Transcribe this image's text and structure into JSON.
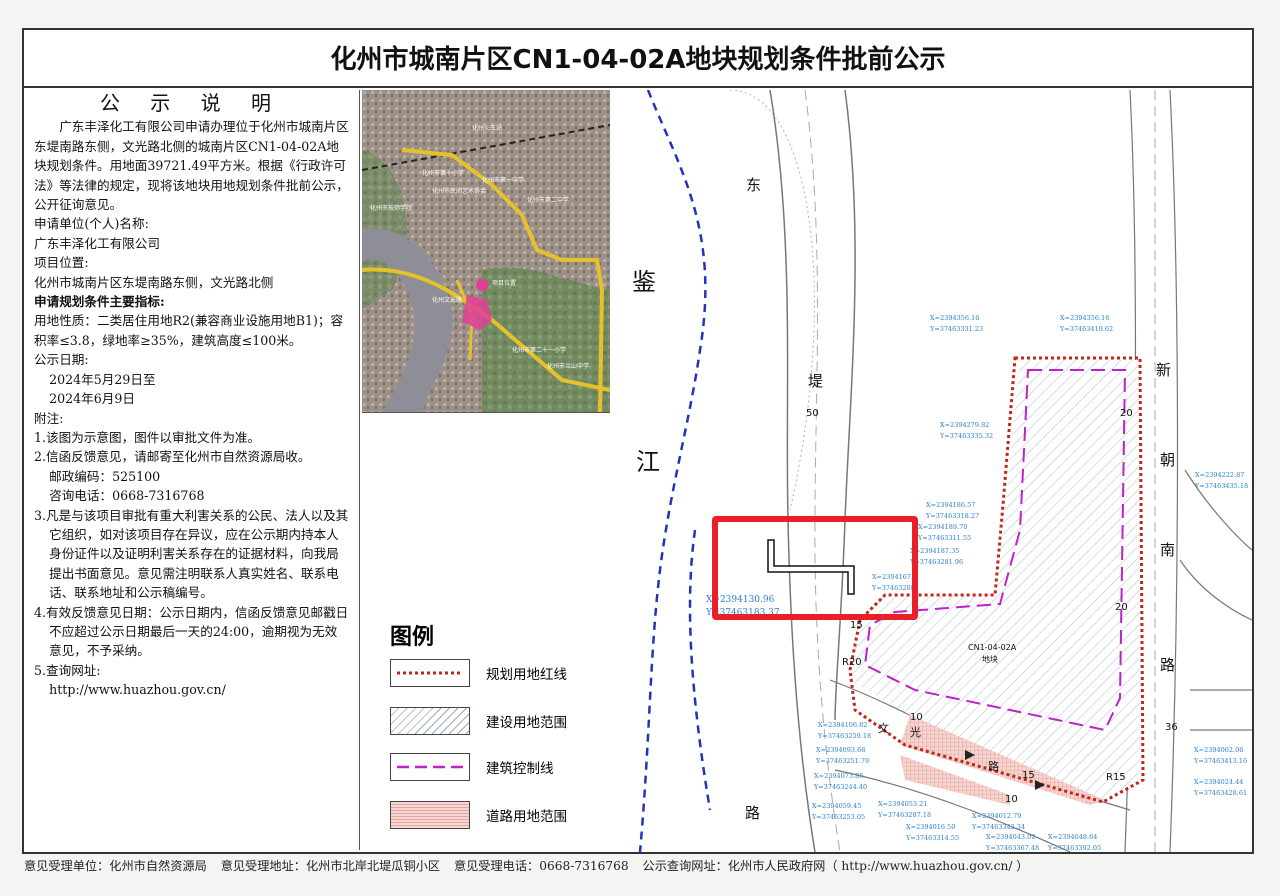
{
  "title": "化州市城南片区CN1-04-02A地块规划条件批前公示",
  "notice": {
    "heading": "公 示 说 明",
    "intro": "广东丰泽化工有限公司申请办理位于化州市城南片区东堤南路东侧，文光路北侧的城南片区CN1-04-02A地块规划条件。用地面39721.49平方米。根据《行政许可法》等法律的规定，现将该地块用地规划条件批前公示，公开征询意见。",
    "applicant_label": "申请单位(个人)名称:",
    "applicant": "广东丰泽化工有限公司",
    "location_label": "项目位置:",
    "location": "化州市城南片区东堤南路东侧，文光路北侧",
    "indicators_label": "申请规划条件主要指标:",
    "indicators": "用地性质：二类居住用地R2(兼容商业设施用地B1)；容积率≤3.8，绿地率≥35%，建筑高度≤100米。",
    "date_label": "公示日期:",
    "date_from": "2024年5月29日至",
    "date_to": "2024年6月9日",
    "notes_label": "附注:",
    "note1": "1.该图为示意图，图件以审批文件为准。",
    "note2": "2.信函反馈意见，请邮寄至化州市自然资源局收。",
    "postcode": "邮政编码：525100",
    "phone": "咨询电话：0668-7316768",
    "note3": "3.凡是与该项目审批有重大利害关系的公民、法人以及其它组织，如对该项目存在异议，应在公示期内持本人身份证件以及证明利害关系存在的证据材料，向我局提出书面意见。意见需注明联系人真实姓名、联系电话、联系地址和公示稿编号。",
    "note4": "4.有效反馈意见日期：公示日期内，信函反馈意见邮戳日不应超过公示日期最后一天的24:00，逾期视为无效意见，不予采纳。",
    "note5": "5.查询网址:",
    "url": "http://www.huazhou.gov.cn/"
  },
  "aerial": {
    "labels": [
      "化州火车站",
      "化州市第十小学",
      "化州市民间艺术协会",
      "化州市第一中学",
      "化州市第二中学",
      "化州市技师学院",
      "项目位置",
      "化州文光路",
      "化州市第二十一小学",
      "化州市兰山中学"
    ]
  },
  "legend": {
    "title": "图例",
    "items": [
      {
        "label": "规划用地红线",
        "color": "#c0271a"
      },
      {
        "label": "建设用地范围",
        "color": "#8fa0b8"
      },
      {
        "label": "建筑控制线",
        "color": "#c020c8"
      },
      {
        "label": "道路用地范围",
        "color": "#d9776f"
      }
    ]
  },
  "map": {
    "road_chars": [
      "鉴",
      "江",
      "东",
      "堤",
      "路",
      "新",
      "朝",
      "南",
      "路"
    ],
    "road_widths": [
      "50",
      "20",
      "20",
      "36",
      "15",
      "R20",
      "10",
      "10",
      "15",
      "R15"
    ],
    "parcel_id": "CN1-04-02A",
    "parcel_word": "地块",
    "wenguang": [
      "文",
      "光",
      "路"
    ],
    "coords": [
      {
        "x": "X=2394356.16",
        "y": "Y=37463331.23"
      },
      {
        "x": "X=2394356.16",
        "y": "Y=37463419.62"
      },
      {
        "x": "X=2394279.82",
        "y": "Y=37463335.32"
      },
      {
        "x": "X=2394222.87",
        "y": "Y=37463435.18"
      },
      {
        "x": "X=2394186.57",
        "y": "Y=37463318.27"
      },
      {
        "x": "X=2394189.70",
        "y": "Y=37463311.55"
      },
      {
        "x": "X=2394187.35",
        "y": "Y=37463281.96"
      },
      {
        "x": "X=2394167.",
        "y": "Y=37463208"
      },
      {
        "x": "X=2394130.96",
        "y": "Y=37463183.37"
      },
      {
        "x": "X=2394106.82",
        "y": "Y=37463259.18"
      },
      {
        "x": "X=2394093.68",
        "y": "Y=37463251.79"
      },
      {
        "x": "X=2394073.85",
        "y": "Y=37463244.40"
      },
      {
        "x": "X=2394059.45",
        "y": "Y=37463253.05"
      },
      {
        "x": "X=2394053.21",
        "y": "Y=37463287.18"
      },
      {
        "x": "X=2394016.50",
        "y": "Y=37463314.55"
      },
      {
        "x": "X=2394012.79",
        "y": "Y=37463342.34"
      },
      {
        "x": "X=2394043.02",
        "y": "Y=37463367.48"
      },
      {
        "x": "X=2394048.64",
        "y": "Y=37463392.05"
      },
      {
        "x": "X=2394062.06",
        "y": "Y=37463413.16"
      },
      {
        "x": "X=2394024.44",
        "y": "Y=37463428.61"
      }
    ]
  },
  "footer": {
    "unit": "意见受理单位：化州市自然资源局",
    "address": "意见受理地址：化州市北岸北堤瓜铜小区",
    "phone": "意见受理电话：0668-7316768",
    "site": "公示查询网址：化州市人民政府网（ http://www.huazhou.gov.cn/ ）"
  },
  "colors": {
    "redline": "#c0271a",
    "highlight": "#e8202a",
    "river_dash": "#2233bb",
    "control": "#c020c8",
    "coord_text": "#2a7fd0"
  }
}
